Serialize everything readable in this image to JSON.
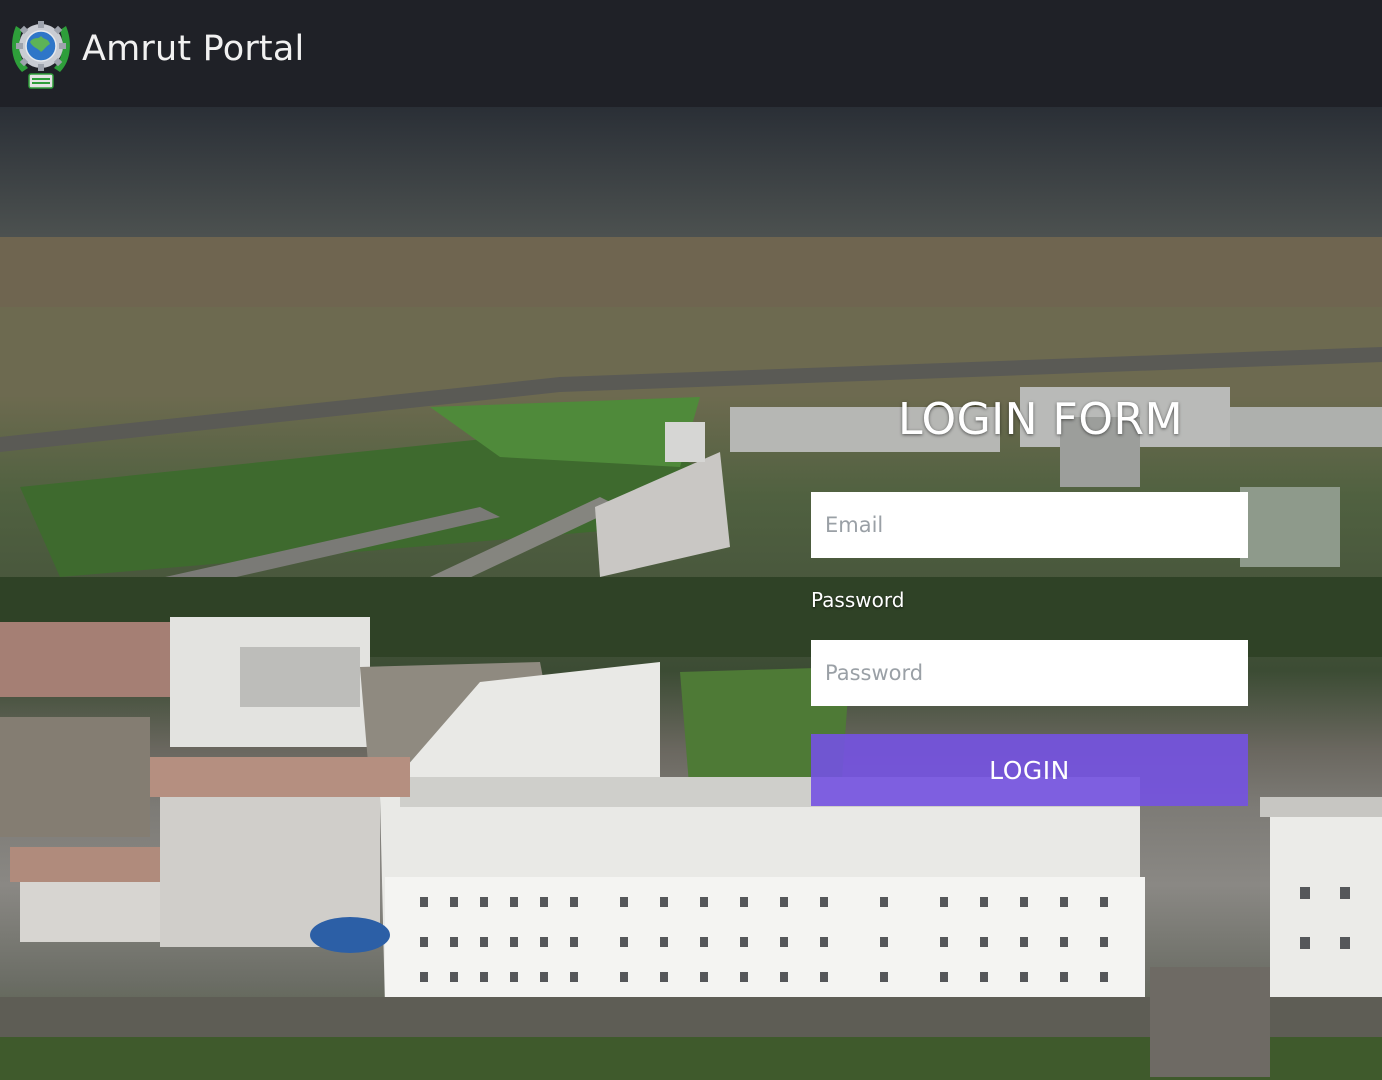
{
  "navbar": {
    "brand": "Amrut Portal",
    "logo_icon": "gear-globe-emblem-icon"
  },
  "login": {
    "title": "LOGIN FORM",
    "email_placeholder": "Email",
    "password_label": "Password",
    "password_placeholder": "Password",
    "button_label": "LOGIN"
  },
  "colors": {
    "navbar_bg": "#1f2127",
    "button_bg": "#7452e2",
    "logo_green": "#2e9e3a"
  }
}
